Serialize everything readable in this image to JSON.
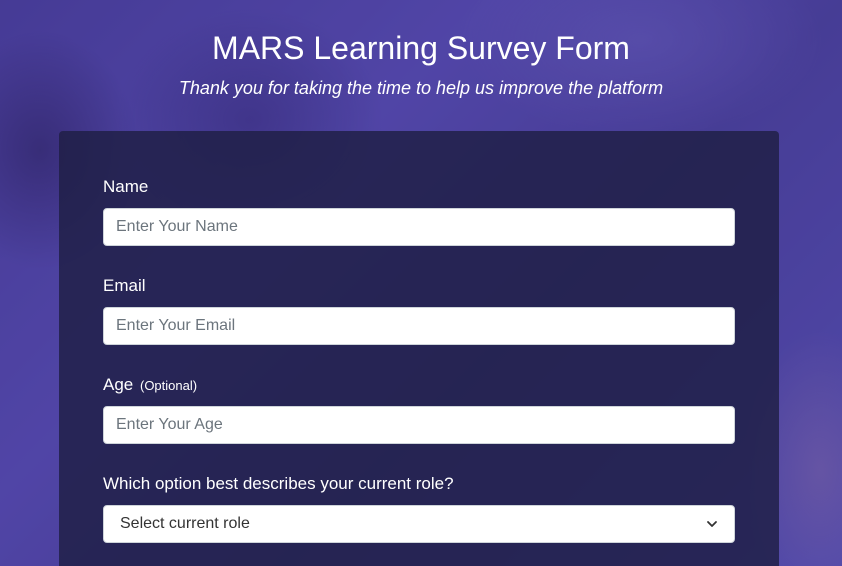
{
  "header": {
    "title": "MARS Learning Survey Form",
    "subtitle": "Thank you for taking the time to help us improve the platform"
  },
  "form": {
    "name": {
      "label": "Name",
      "placeholder": "Enter Your Name",
      "value": ""
    },
    "email": {
      "label": "Email",
      "placeholder": "Enter Your Email",
      "value": ""
    },
    "age": {
      "label": "Age",
      "optional_note": "(Optional)",
      "placeholder": "Enter Your Age",
      "value": ""
    },
    "role": {
      "label": "Which option best describes your current role?",
      "selected": "Select current role",
      "icon": "chevron-down-icon"
    }
  },
  "colors": {
    "background": "#4a3f96",
    "card": "#1e1e44",
    "text": "#ffffff",
    "input_border": "#ced4da",
    "placeholder": "#6c757d"
  }
}
